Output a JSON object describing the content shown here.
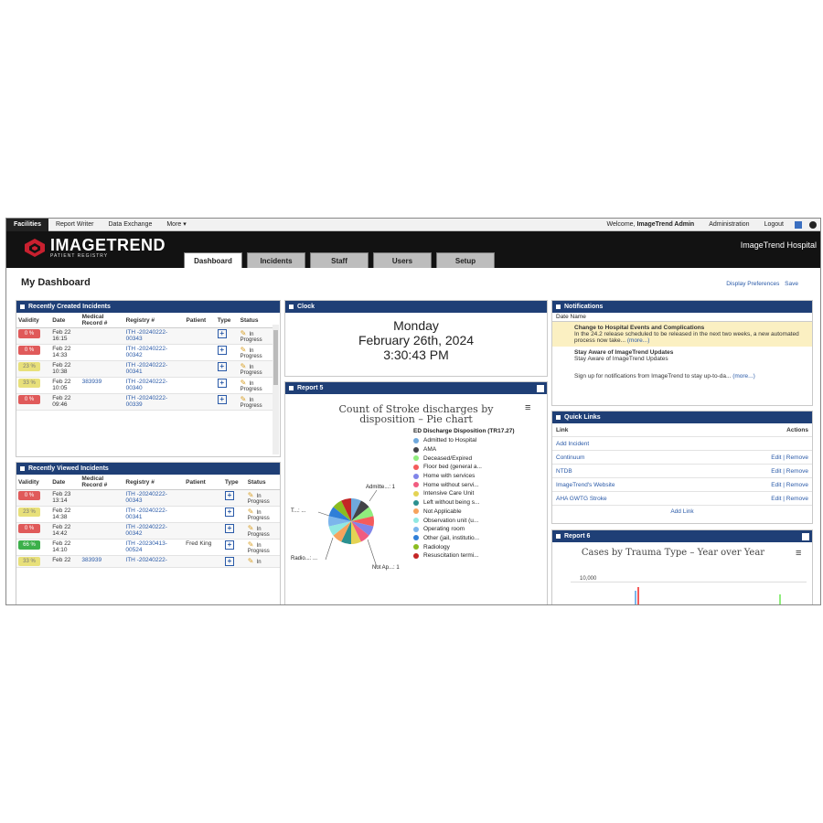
{
  "topbar": {
    "items": [
      "Facilities",
      "Report Writer",
      "Data Exchange",
      "More ▾"
    ],
    "welcome_prefix": "Welcome,",
    "user": "ImageTrend Admin",
    "administration": "Administration",
    "logout": "Logout"
  },
  "header": {
    "logo_line1": "IMAGETREND",
    "logo_line2": "PATIENT REGISTRY",
    "hospital": "ImageTrend Hospital",
    "tabs": [
      "Dashboard",
      "Incidents",
      "Staff",
      "Users",
      "Setup"
    ]
  },
  "dashboard": {
    "title": "My Dashboard",
    "display_prefs": "Display Preferences",
    "save": "Save"
  },
  "recent_created": {
    "title": "Recently Created Incidents",
    "columns": [
      "Validity",
      "Date",
      "Medical Record #",
      "Registry #",
      "Patient",
      "Type",
      "Status"
    ],
    "rows": [
      {
        "validity": "0 %",
        "vcolor": "#e05a5a",
        "date1": "Feb 22",
        "date2": "16:15",
        "mrn": "",
        "reg1": "ITH -20240222-",
        "reg2": "00343",
        "patient": "",
        "status1": "In",
        "status2": "Progress"
      },
      {
        "validity": "0 %",
        "vcolor": "#e05a5a",
        "date1": "Feb 22",
        "date2": "14:33",
        "mrn": "",
        "reg1": "ITH -20240222-",
        "reg2": "00342",
        "patient": "",
        "status1": "In",
        "status2": "Progress"
      },
      {
        "validity": "23 %",
        "vcolor": "#e8e07a",
        "date1": "Feb 22",
        "date2": "10:38",
        "mrn": "",
        "reg1": "ITH -20240222-",
        "reg2": "00341",
        "patient": "",
        "status1": "In",
        "status2": "Progress"
      },
      {
        "validity": "33 %",
        "vcolor": "#e8e07a",
        "date1": "Feb 22",
        "date2": "10:05",
        "mrn": "383939",
        "reg1": "ITH -20240222-",
        "reg2": "00340",
        "patient": "",
        "status1": "In",
        "status2": "Progress"
      },
      {
        "validity": "0 %",
        "vcolor": "#e05a5a",
        "date1": "Feb 22",
        "date2": "09:46",
        "mrn": "",
        "reg1": "ITH -20240222-",
        "reg2": "00339",
        "patient": "",
        "status1": "In",
        "status2": "Progress"
      }
    ]
  },
  "recent_viewed": {
    "title": "Recently Viewed Incidents",
    "columns": [
      "Validity",
      "Date",
      "Medical Record #",
      "Registry #",
      "Patient",
      "Type",
      "Status"
    ],
    "rows": [
      {
        "validity": "0 %",
        "vcolor": "#e05a5a",
        "date1": "Feb 23",
        "date2": "13:14",
        "mrn": "",
        "reg1": "ITH -20240222-",
        "reg2": "00343",
        "patient": "",
        "status1": "In",
        "status2": "Progress"
      },
      {
        "validity": "23 %",
        "vcolor": "#e8e07a",
        "date1": "Feb 22",
        "date2": "14:38",
        "mrn": "",
        "reg1": "ITH -20240222-",
        "reg2": "00341",
        "patient": "",
        "status1": "In",
        "status2": "Progress"
      },
      {
        "validity": "0 %",
        "vcolor": "#e05a5a",
        "date1": "Feb 22",
        "date2": "14:42",
        "mrn": "",
        "reg1": "ITH -20240222-",
        "reg2": "00342",
        "patient": "",
        "status1": "In",
        "status2": "Progress"
      },
      {
        "validity": "66 %",
        "vcolor": "#3cb04a",
        "date1": "Feb 22",
        "date2": "14:10",
        "mrn": "",
        "reg1": "ITH -20230413-",
        "reg2": "00524",
        "patient": "Fred King",
        "status1": "In",
        "status2": "Progress"
      },
      {
        "validity": "33 %",
        "vcolor": "#e8e07a",
        "date1": "Feb 22",
        "date2": "",
        "mrn": "383939",
        "reg1": "ITH -20240222-",
        "reg2": "",
        "patient": "",
        "status1": "In",
        "status2": ""
      }
    ]
  },
  "clock": {
    "title": "Clock",
    "day": "Monday",
    "date": "February 26th, 2024",
    "time": "3:30:43 PM"
  },
  "report5": {
    "title": "Report 5",
    "chart_title_l1": "Count of Stroke discharges by",
    "chart_title_l2": "disposition – Pie chart",
    "legend_title": "ED Discharge Disposition (TR17.27)",
    "pie_labels": [
      "Admitte...: 1",
      "T...: ...",
      "Radio...: ...",
      "Not Ap...: 1"
    ]
  },
  "chart_data": {
    "type": "pie",
    "title": "Count of Stroke discharges by disposition – Pie chart",
    "legend_title": "ED Discharge Disposition (TR17.27)",
    "categories": [
      "Admitted to Hospital",
      "AMA",
      "Deceased/Expired",
      "Floor bed (general a...",
      "Home with services",
      "Home without servi...",
      "Intensive Care Unit",
      "Left without being s...",
      "Not Applicable",
      "Observation unit (u...",
      "Operating room",
      "Other (jail, institutio...",
      "Radiology",
      "Resuscitation termi..."
    ],
    "values": [
      1,
      1,
      1,
      1,
      1,
      1,
      1,
      1,
      1,
      1,
      1,
      1,
      1,
      1
    ],
    "colors": [
      "#6fa8dc",
      "#434348",
      "#90ed7d",
      "#f45b5b",
      "#8085e9",
      "#f15c80",
      "#e4d354",
      "#2b908f",
      "#f7a35c",
      "#91e8e1",
      "#7cb5ec",
      "#2f7ed8",
      "#8bbc21",
      "#c42525"
    ],
    "legend": "right"
  },
  "notifications": {
    "title": "Notifications",
    "columns": [
      "Date",
      "Name"
    ],
    "items": [
      {
        "title": "Change to Hospital Events and Complications",
        "body": "In the 24.2 release scheduled to be released in the next two weeks, a new automated process now take...",
        "more": "(more...)"
      },
      {
        "title": "Stay Aware of ImageTrend Updates",
        "body": "Stay Aware of ImageTrend Updates",
        "more": ""
      },
      {
        "title": "",
        "body": "Sign up for notifications from ImageTrend to stay up-to-da...",
        "more": "(more...)"
      }
    ]
  },
  "quick_links": {
    "title": "Quick Links",
    "col_link": "Link",
    "col_actions": "Actions",
    "items": [
      {
        "name": "Add Incident",
        "actions": ""
      },
      {
        "name": "Continuum",
        "actions": "Edit | Remove"
      },
      {
        "name": "NTDB",
        "actions": "Edit | Remove"
      },
      {
        "name": "ImageTrend's Website",
        "actions": "Edit | Remove"
      },
      {
        "name": "AHA GWTG Stroke",
        "actions": "Edit | Remove"
      }
    ],
    "add_link": "Add Link"
  },
  "report6": {
    "title": "Report 6",
    "chart_title": "Cases by Trauma Type – Year over Year",
    "y_tick": "10,000"
  },
  "colors": {
    "panel_header": "#1f3f76",
    "header_bg": "#121212",
    "link": "#2a5aa8"
  }
}
